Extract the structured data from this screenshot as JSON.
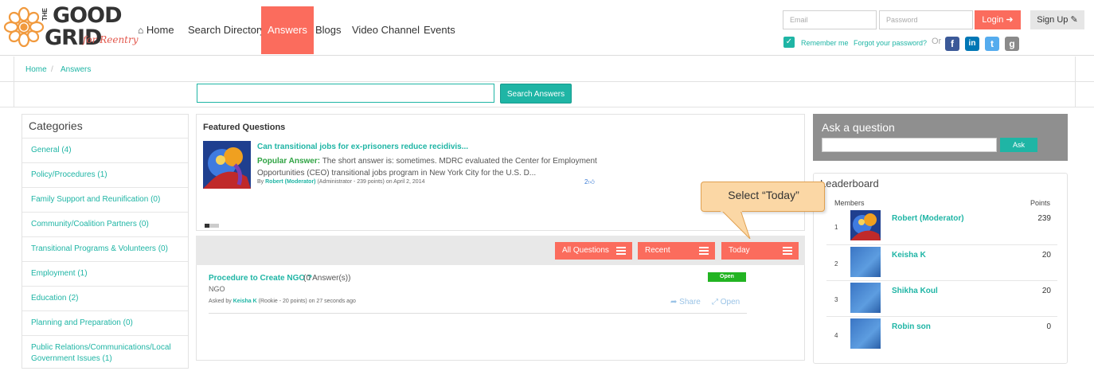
{
  "logo": {
    "the": "THE",
    "good": "GOOD",
    "grid": "GRID",
    "tagline": "for Reentry"
  },
  "nav": {
    "home": "Home",
    "search_directory": "Search Directory",
    "answers": "Answers",
    "blogs": "Blogs",
    "video_channel": "Video Channel",
    "events": "Events"
  },
  "auth": {
    "email_placeholder": "Email",
    "password_placeholder": "Password",
    "login": "Login",
    "signup": "Sign Up",
    "remember_me": "Remember me",
    "forgot_password": "Forgot your password?",
    "or": "Or"
  },
  "social": [
    {
      "icon": "facebook-icon",
      "glyph": "f",
      "color": "#3b5998"
    },
    {
      "icon": "linkedin-icon",
      "glyph": "in",
      "color": "#0077b5"
    },
    {
      "icon": "twitter-icon",
      "glyph": "t",
      "color": "#55acee"
    },
    {
      "icon": "google-icon",
      "glyph": "g",
      "color": "#8a8a8a"
    }
  ],
  "breadcrumb": {
    "home": "Home",
    "separator": "/",
    "answers": "Answers"
  },
  "search": {
    "button": "Search Answers"
  },
  "categories": {
    "title": "Categories",
    "items": [
      "General (4)",
      "Policy/Procedures (1)",
      "Family Support and Reunification (0)",
      "Community/Coalition Partners (0)",
      "Transitional Programs & Volunteers (0)",
      "Employment (1)",
      "Education (2)",
      "Planning and Preparation (0)",
      "Public Relations/Communications/Local Government Issues (1)"
    ]
  },
  "featured": {
    "title": "Featured Questions",
    "question": "Can transitional jobs for ex-prisoners reduce recidivis...",
    "answer_label": "Popular Answer:",
    "answer_text": " The short answer is: sometimes. MDRC evaluated the Center for Employment Opportunities (CEO) transitional jobs program in New York City for the U.S. D...",
    "by_prefix": "By ",
    "by_name": "Robert (Moderator)",
    "by_suffix": " (Administrator - 239 points)  on April 2, 2014",
    "likes": "2"
  },
  "filters": {
    "all": "All Questions",
    "recent": "Recent",
    "today": "Today"
  },
  "question": {
    "title": "Procedure to Create NGO ?",
    "count": " (0 Answer(s))",
    "category": "NGO",
    "asked_prefix": "Asked by ",
    "asked_name": "Keisha K",
    "asked_suffix": " (Rookie - 20 points) on 27 seconds ago",
    "status": "Open",
    "share": "Share",
    "open": "Open"
  },
  "callout": {
    "text": "Select “Today”"
  },
  "ask": {
    "title": "Ask a question",
    "button": "Ask"
  },
  "leaderboard": {
    "title": "Leaderboard",
    "members_label": "Members",
    "points_label": "Points",
    "rows": [
      {
        "rank": "1",
        "name": "Robert (Moderator)",
        "points": "239"
      },
      {
        "rank": "2",
        "name": "Keisha K",
        "points": "20"
      },
      {
        "rank": "3",
        "name": "Shikha Koul",
        "points": "20"
      },
      {
        "rank": "4",
        "name": "Robin son",
        "points": "0"
      }
    ]
  },
  "colors": {
    "accent": "#1fb5a5",
    "brand": "#fb6c5d",
    "status_open": "#22b422",
    "callout": "#fbd7a5"
  }
}
